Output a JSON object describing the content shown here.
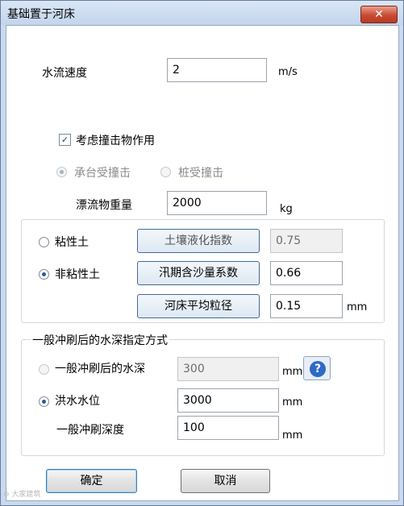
{
  "window": {
    "title": "基础置于河床",
    "close_label": "✕"
  },
  "flow": {
    "label": "水流速度",
    "value": "2",
    "unit": "m/s"
  },
  "impact": {
    "checkbox_label": "考虑撞击物作用",
    "checked": true,
    "radio_cap": "承台受撞击",
    "radio_pile": "桩受撞击",
    "drift_label": "漂流物重量",
    "drift_value": "2000",
    "drift_unit": "kg"
  },
  "soil": {
    "cohesive_label": "粘性土",
    "liquefaction_button": "土壤液化指数",
    "liquefaction_value": "0.75",
    "noncohesive_label": "非粘性土",
    "sediment_button": "汛期含沙量系数",
    "sediment_value": "0.66",
    "grain_button": "河床平均粒径",
    "grain_value": "0.15",
    "grain_unit": "mm"
  },
  "scour": {
    "group_title": "一般冲刷后的水深指定方式",
    "depth_radio_label": "一般冲刷后的水深",
    "depth_value": "300",
    "depth_unit": "mm",
    "flood_label": "洪水水位",
    "flood_value": "3000",
    "flood_unit": "mm",
    "scour_depth_label": "一般冲刷深度",
    "scour_depth_value": "100",
    "scour_depth_unit": "mm"
  },
  "buttons": {
    "ok": "确定",
    "cancel": "取消"
  },
  "watermark": "⊕ 大家建筑"
}
